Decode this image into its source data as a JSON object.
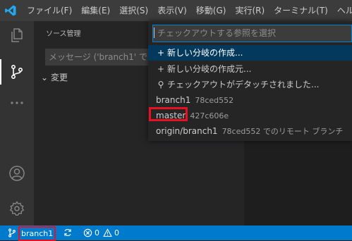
{
  "titlebar": {
    "menus": [
      "ファイル(F)",
      "編集(E)",
      "選択(S)",
      "表示(V)",
      "移動(G)",
      "実行(R)",
      "ターミナル(T)",
      "ヘルプ"
    ]
  },
  "activitybar": {
    "icons": [
      "explorer-icon",
      "source-control-icon",
      "more-icon",
      "account-icon",
      "settings-gear-icon"
    ]
  },
  "sidebar": {
    "title": "ソース管理",
    "commit_placeholder": "メッセージ ('branch1' で",
    "changes_label": "変更",
    "changes_chevron": "⌄"
  },
  "quickpick": {
    "placeholder": "チェックアウトする参照を選択",
    "items": [
      {
        "glyph": "+",
        "label": "新しい分岐の作成...",
        "desc": ""
      },
      {
        "glyph": "+",
        "label": "新しい分岐の作成元...",
        "desc": ""
      },
      {
        "glyph": "⚲",
        "label": "チェックアウトがデタッチされました...",
        "desc": ""
      },
      {
        "glyph": "",
        "label": "branch1",
        "desc": "78ced552"
      },
      {
        "glyph": "",
        "label": "master",
        "desc": "427c606e"
      },
      {
        "glyph": "",
        "label": "origin/branch1",
        "desc": "78ced552 でのリモート ブランチ"
      }
    ]
  },
  "statusbar": {
    "branch": "branch1",
    "errors": "0",
    "warnings": "0"
  },
  "colors": {
    "accent": "#007acc",
    "highlight_box": "#e81123",
    "selected_row": "#04395e"
  }
}
